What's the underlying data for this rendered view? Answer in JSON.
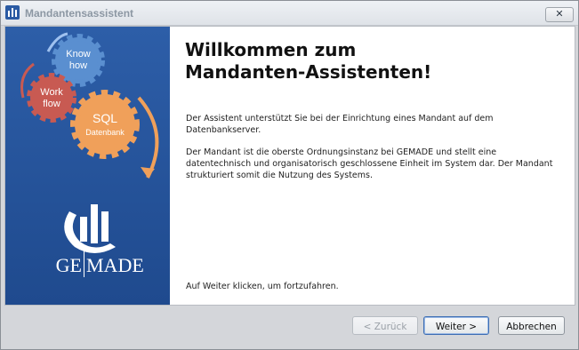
{
  "window": {
    "title": "Mandantensassistent",
    "close_symbol": "✕",
    "icon": "app-icon"
  },
  "sidebar": {
    "gears": [
      {
        "label": "Know how"
      },
      {
        "label": "Work flow"
      },
      {
        "label": "SQL",
        "sublabel": "Datenbank"
      }
    ],
    "logo_text_left": "GE",
    "logo_text_right": "MADE"
  },
  "main": {
    "heading_line1": "Willkommen zum",
    "heading_line2": "Mandanten-Assistenten!",
    "paragraph1": "Der Assistent unterstützt Sie bei der Einrichtung eines Mandant auf dem Datenbankserver.",
    "paragraph2": "Der Mandant ist die oberste Ordnungsinstanz bei GEMADE und stellt eine datentechnisch und organisatorisch geschlossene Einheit im System dar. Der Mandant strukturiert somit die Nutzung des Systems.",
    "footer_hint": "Auf Weiter klicken, um fortzufahren."
  },
  "buttons": {
    "back": "< Zurück",
    "next": "Weiter >",
    "cancel": "Abbrechen"
  },
  "colors": {
    "sidebar_blue": "#2a5aa3",
    "gear_blue": "#5a8fd0",
    "gear_red": "#c85a52",
    "gear_orange": "#f0a05a"
  }
}
